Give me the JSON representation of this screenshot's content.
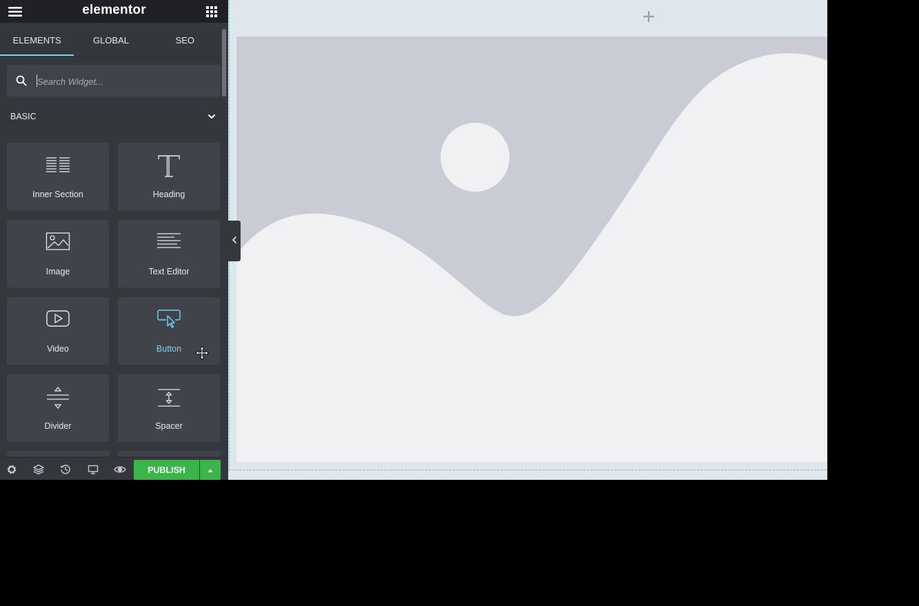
{
  "header": {
    "brand": "elementor",
    "menu_icon": "hamburger-icon",
    "apps_icon": "grid-icon"
  },
  "tabs": [
    {
      "label": "ELEMENTS",
      "active": true
    },
    {
      "label": "GLOBAL",
      "active": false
    },
    {
      "label": "SEO",
      "active": false
    }
  ],
  "search": {
    "placeholder": "Search Widget...",
    "value": "",
    "icon": "search-icon"
  },
  "category": {
    "title": "BASIC",
    "expanded": true,
    "icon": "chevron-down-icon"
  },
  "widgets": [
    {
      "label": "Inner Section",
      "icon": "columns-icon"
    },
    {
      "label": "Heading",
      "icon": "heading-icon"
    },
    {
      "label": "Image",
      "icon": "image-icon"
    },
    {
      "label": "Text Editor",
      "icon": "text-editor-icon"
    },
    {
      "label": "Video",
      "icon": "video-icon"
    },
    {
      "label": "Button",
      "icon": "button-icon",
      "hovered": true
    },
    {
      "label": "Divider",
      "icon": "divider-icon"
    },
    {
      "label": "Spacer",
      "icon": "spacer-icon"
    }
  ],
  "footer": {
    "icons": [
      "settings-icon",
      "navigator-icon",
      "history-icon",
      "responsive-icon",
      "preview-icon"
    ],
    "publish_label": "PUBLISH",
    "publish_more_icon": "caret-up-icon"
  },
  "colors": {
    "panel_bg": "#34383c",
    "header_bg": "#1f2124",
    "widget_bg": "#404349",
    "accent": "#71d7f7",
    "publish": "#39b54a",
    "preview_bg": "#dfe6ec",
    "placeholder_bg": "#c9ccd5",
    "placeholder_fg": "#f1f1f4"
  }
}
